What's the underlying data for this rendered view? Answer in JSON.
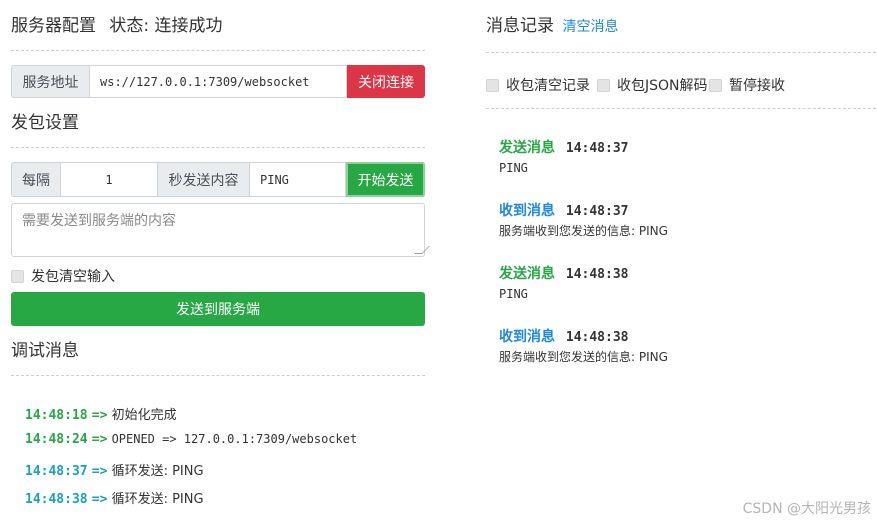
{
  "server": {
    "title": "服务器配置",
    "status_prefix": "状态:",
    "status": "连接成功",
    "address_label": "服务地址",
    "address_value": "ws://127.0.0.1:7309/websocket",
    "close_button": "关闭连接"
  },
  "send_settings": {
    "title": "发包设置",
    "every_label": "每隔",
    "interval_value": "1",
    "seconds_label": "秒发送内容",
    "content_value": "PING",
    "start_button": "开始发送",
    "textarea_placeholder": "需要发送到服务端的内容",
    "clear_after_send_label": "发包清空输入",
    "send_button": "发送到服务端"
  },
  "debug": {
    "title": "调试消息",
    "lines": [
      {
        "time": "14:48:18",
        "arrow": "=>",
        "text": "初始化完成"
      },
      {
        "time": "14:48:24",
        "arrow": "=>",
        "text": "OPENED => 127.0.0.1:7309/websocket"
      },
      {
        "time": "14:48:37",
        "arrow": "=>",
        "text": "循环发送: PING"
      },
      {
        "time": "14:48:38",
        "arrow": "=>",
        "text": "循环发送: PING"
      }
    ]
  },
  "messages": {
    "title": "消息记录",
    "clear_link": "清空消息",
    "options": [
      "收包清空记录",
      "收包JSON解码",
      "暂停接收"
    ],
    "items": [
      {
        "kind": "发送消息",
        "time": "14:48:37",
        "body": "PING"
      },
      {
        "kind": "收到消息",
        "time": "14:48:37",
        "body": "服务端收到您发送的信息: PING"
      },
      {
        "kind": "发送消息",
        "time": "14:48:38",
        "body": "PING"
      },
      {
        "kind": "收到消息",
        "time": "14:48:38",
        "body": "服务端收到您发送的信息: PING"
      }
    ]
  },
  "watermark": "CSDN @大阳光男孩",
  "colors": {
    "danger": "#dc3545",
    "success": "#28a745",
    "link": "#1e88e5",
    "info": "#17a2b8"
  }
}
